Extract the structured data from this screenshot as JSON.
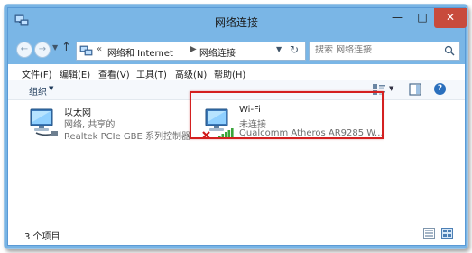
{
  "window": {
    "title": "网络连接",
    "min_glyph": "—",
    "max_glyph": "□",
    "close_glyph": "✕"
  },
  "address": {
    "back_glyph": "←",
    "forward_glyph": "→",
    "history_glyph": "▼",
    "up_glyph": "↑",
    "separator": "«",
    "crumb_separator": "▶",
    "crumbs": [
      "网络和 Internet",
      "网络连接"
    ],
    "dropdown_glyph": "▼",
    "refresh_glyph": "↻"
  },
  "search": {
    "placeholder": "搜索 网络连接"
  },
  "menu": {
    "items": [
      "文件(F)",
      "编辑(E)",
      "查看(V)",
      "工具(T)",
      "高级(N)",
      "帮助(H)"
    ]
  },
  "commandbar": {
    "organize_label": "组织",
    "organize_caret": "▼",
    "view_caret": "▼",
    "help_glyph": "?"
  },
  "connections": [
    {
      "name": "以太网",
      "status": "网络, 共享的",
      "adapter": "Realtek PCIe GBE 系列控制器"
    },
    {
      "name": "Wi-Fi",
      "status": "未连接",
      "adapter": "Qualcomm Atheros AR9285 W..."
    }
  ],
  "statusbar": {
    "item_count": "3 个项目"
  },
  "colors": {
    "titlebar": "#7ab6e6",
    "close_button": "#c84b3c",
    "highlight_border": "#d42020",
    "secondary_text": "#6d6d6d"
  }
}
